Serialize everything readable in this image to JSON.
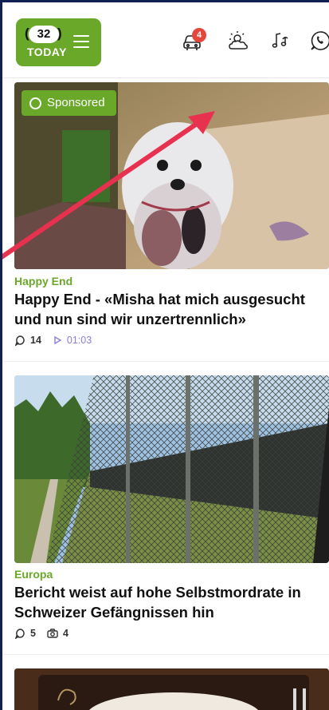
{
  "header": {
    "logo_number": "32",
    "logo_text": "TODAY",
    "traffic_badge": "4",
    "icons": [
      "menu-icon",
      "traffic-car-icon",
      "weather-icon",
      "music-icon",
      "whatsapp-icon"
    ]
  },
  "articles": [
    {
      "sponsored_label": "Sponsored",
      "category": "Happy End",
      "title": "Happy End - «Misha hat mich ausgesucht und nun sind wir unzertrennlich»",
      "comments": "14",
      "video_duration": "01:03"
    },
    {
      "category": "Europa",
      "title": "Bericht weist auf hohe Selbstmordrate in Schweizer Gefängnissen hin",
      "comments": "5",
      "photos": "4"
    }
  ],
  "colors": {
    "brand_green": "#6aa82a",
    "badge_red": "#e5463c",
    "annotation_arrow": "#e8304f",
    "video_purple": "#8b7fd6"
  }
}
